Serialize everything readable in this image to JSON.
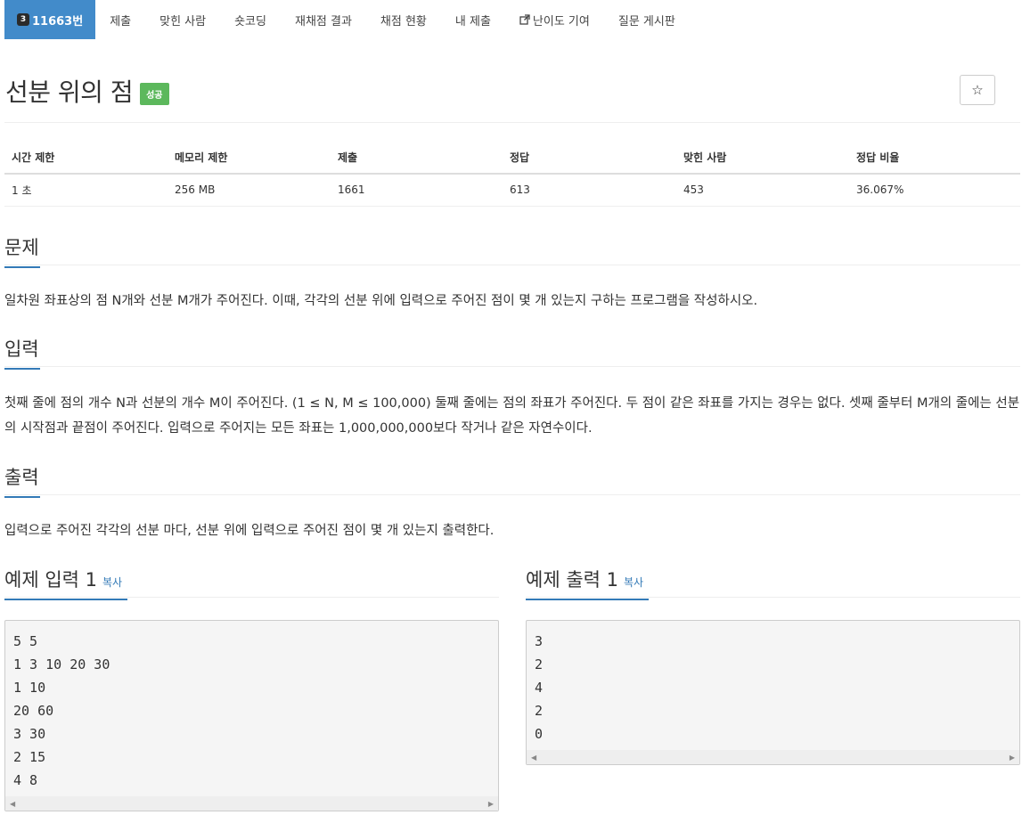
{
  "nav": {
    "problem_badge": "3",
    "problem_tab": "11663번",
    "items": [
      "제출",
      "맞힌 사람",
      "숏코딩",
      "재채점 결과",
      "채점 현황",
      "내 제출",
      "난이도 기여",
      "질문 게시판"
    ]
  },
  "title": "선분 위의 점",
  "status": "성공",
  "star": "☆",
  "info": {
    "headers": [
      "시간 제한",
      "메모리 제한",
      "제출",
      "정답",
      "맞힌 사람",
      "정답 비율"
    ],
    "values": [
      "1 초",
      "256 MB",
      "1661",
      "613",
      "453",
      "36.067%"
    ]
  },
  "sections": {
    "problem": {
      "heading": "문제",
      "text": "일차원 좌표상의 점 N개와 선분 M개가 주어진다. 이때, 각각의 선분 위에 입력으로 주어진 점이 몇 개 있는지 구하는 프로그램을 작성하시오."
    },
    "input": {
      "heading": "입력",
      "text": "첫째 줄에 점의 개수 N과 선분의 개수 M이 주어진다. (1 ≤ N, M ≤ 100,000) 둘째 줄에는 점의 좌표가 주어진다. 두 점이 같은 좌표를 가지는 경우는 없다. 셋째 줄부터 M개의 줄에는 선분의 시작점과 끝점이 주어진다. 입력으로 주어지는 모든 좌표는 1,000,000,000보다 작거나 같은 자연수이다."
    },
    "output": {
      "heading": "출력",
      "text": "입력으로 주어진 각각의 선분 마다, 선분 위에 입력으로 주어진 점이 몇 개 있는지 출력한다."
    }
  },
  "samples": {
    "input": {
      "heading": "예제 입력 1",
      "copy": "복사",
      "content": "5 5\n1 3 10 20 30\n1 10\n20 60\n3 30\n2 15\n4 8"
    },
    "output": {
      "heading": "예제 출력 1",
      "copy": "복사",
      "content": "3\n2\n4\n2\n0"
    }
  },
  "colors": {
    "accent": "#428bca",
    "success": "#5cb85c",
    "link": "#337ab7"
  }
}
